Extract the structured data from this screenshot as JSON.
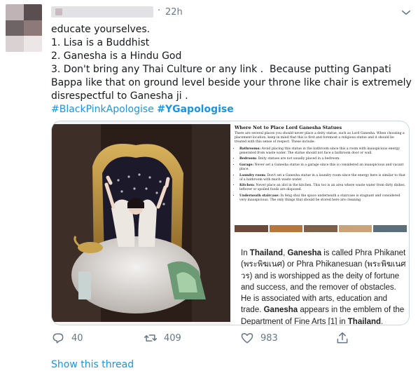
{
  "tweet": {
    "timestamp": "22h",
    "separator": "·",
    "text_lines": [
      "educate yourselves.",
      "1. Lisa is a Buddhist",
      "2. Ganesha is a Hindu God",
      "3. Don't bring any Thai Culture or any link .  Because putting Ganpati",
      "Bappa like that on ground level beside your throne like chair is extremely",
      "disrespectful to Ganesha ji ."
    ],
    "hashtag_1": "#BlackPinkApologise",
    "hashtag_2": "#YGapologise",
    "show_thread": "Show this thread"
  },
  "article": {
    "title": "Where Not to Place Lord Ganesha Statues",
    "intro": "There are several places you should never place a deity statue, such as Lord Ganesha. When choosing a placement location, keep in mind that this is first and foremost a religious statue and it should be treated with this sense of respect. These include:",
    "items": [
      {
        "label": "Bathrooms:",
        "text": " Avoid placing this statue in the bathroom since this a room with inauspicious energy generated from waste water. The statue should not face a bathroom door or wall."
      },
      {
        "label": "Bedroom:",
        "text": " Deity statues are not usually placed in a bedroom."
      },
      {
        "label": "Garage:",
        "text": " Never set a Ganesha statue in a garage since this is considered an inauspicious and vacant place."
      },
      {
        "label": "Laundry room:",
        "text": " Don't set a Ganesha statue in a laundry room since the energy here is similar to that of a bathroom with much waste water."
      },
      {
        "label": "Kitchen:",
        "text": " Never place an idol in the kitchen. This too is an area where waste water from dirty dishes, leftover or spoiled foods are disposed."
      },
      {
        "label": "Underneath staircase:",
        "text": " In feng shui the space underneath a staircase is stagnant and considered very inauspicious. The only things that should be stored here are cleaning"
      }
    ]
  },
  "wiki": {
    "p1": "In ",
    "p2": "Thailand",
    "p3": ", ",
    "p4": "Ganesha",
    "p5": " is called Phra Phikanet (พระพิฆเนศ) or Phra Phikanesuan (พระพิฆเนศวร) and is worshipped as the deity of fortune and success, and the remover of obstacles. He is associated with arts, education and trade. ",
    "p6": "Ganesha",
    "p7": " appears in the emblem of the Department of Fine Arts [1] in ",
    "p8": "Thailand",
    "p9": "."
  },
  "actions": {
    "reply_count": "40",
    "retweet_count": "409",
    "like_count": "983"
  },
  "icons": {
    "reply": "reply-icon",
    "retweet": "retweet-icon",
    "like": "heart-icon",
    "share": "share-icon",
    "more": "chevron-down-icon"
  },
  "colors": {
    "link": "#1b95e0",
    "meta": "#657786",
    "text": "#14171a",
    "border": "#ccd6dd"
  }
}
